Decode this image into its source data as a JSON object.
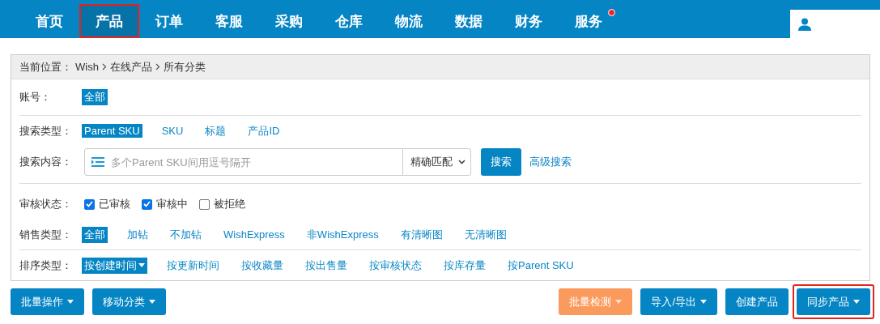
{
  "nav": {
    "items": [
      {
        "label": "首页",
        "selected": false,
        "highlighted": false,
        "badge": false
      },
      {
        "label": "产品",
        "selected": true,
        "highlighted": true,
        "badge": false
      },
      {
        "label": "订单",
        "selected": false,
        "highlighted": false,
        "badge": false
      },
      {
        "label": "客服",
        "selected": false,
        "highlighted": false,
        "badge": false
      },
      {
        "label": "采购",
        "selected": false,
        "highlighted": false,
        "badge": false
      },
      {
        "label": "仓库",
        "selected": false,
        "highlighted": false,
        "badge": false
      },
      {
        "label": "物流",
        "selected": false,
        "highlighted": false,
        "badge": false
      },
      {
        "label": "数据",
        "selected": false,
        "highlighted": false,
        "badge": false
      },
      {
        "label": "财务",
        "selected": false,
        "highlighted": false,
        "badge": false
      },
      {
        "label": "服务",
        "selected": false,
        "highlighted": false,
        "badge": true
      }
    ]
  },
  "breadcrumb": {
    "label": "当前位置：",
    "items": [
      "Wish",
      "在线产品",
      "所有分类"
    ]
  },
  "filters": [
    {
      "kind": "options",
      "label": "账号：",
      "divider": true,
      "options": [
        {
          "label": "全部",
          "selected": true,
          "dropdown": false
        }
      ]
    },
    {
      "kind": "options",
      "label": "搜索类型：",
      "divider": false,
      "options": [
        {
          "label": "Parent SKU",
          "selected": true,
          "dropdown": false
        },
        {
          "label": "SKU",
          "selected": false,
          "dropdown": false
        },
        {
          "label": "标题",
          "selected": false,
          "dropdown": false
        },
        {
          "label": "产品ID",
          "selected": false,
          "dropdown": false
        }
      ]
    },
    {
      "kind": "search",
      "label": "搜索内容：",
      "divider": true,
      "placeholder": "多个Parent SKU间用逗号隔开",
      "match": "精确匹配",
      "button": "搜索",
      "link": "高级搜索"
    },
    {
      "kind": "checks",
      "label": "审核状态：",
      "divider": false,
      "checks": [
        {
          "label": "已审核",
          "checked": true
        },
        {
          "label": "审核中",
          "checked": true
        },
        {
          "label": "被拒绝",
          "checked": false
        }
      ]
    },
    {
      "kind": "options",
      "label": "销售类型：",
      "divider": true,
      "options": [
        {
          "label": "全部",
          "selected": true,
          "dropdown": false
        },
        {
          "label": "加钻",
          "selected": false,
          "dropdown": false
        },
        {
          "label": "不加钻",
          "selected": false,
          "dropdown": false
        },
        {
          "label": "WishExpress",
          "selected": false,
          "dropdown": false
        },
        {
          "label": "非WishExpress",
          "selected": false,
          "dropdown": false
        },
        {
          "label": "有清晰图",
          "selected": false,
          "dropdown": false
        },
        {
          "label": "无清晰图",
          "selected": false,
          "dropdown": false
        }
      ]
    },
    {
      "kind": "options",
      "label": "排序类型：",
      "divider": false,
      "options": [
        {
          "label": "按创建时间",
          "selected": true,
          "dropdown": true
        },
        {
          "label": "按更新时间",
          "selected": false,
          "dropdown": false
        },
        {
          "label": "按收藏量",
          "selected": false,
          "dropdown": false
        },
        {
          "label": "按出售量",
          "selected": false,
          "dropdown": false
        },
        {
          "label": "按审核状态",
          "selected": false,
          "dropdown": false
        },
        {
          "label": "按库存量",
          "selected": false,
          "dropdown": false
        },
        {
          "label": "按Parent SKU",
          "selected": false,
          "dropdown": false
        }
      ]
    }
  ],
  "actions_left": [
    {
      "label": "批量操作",
      "kind": "primary",
      "dropdown": true,
      "highlighted": false
    },
    {
      "label": "移动分类",
      "kind": "primary",
      "dropdown": true,
      "highlighted": false
    }
  ],
  "actions_right": [
    {
      "label": "批量检测",
      "kind": "warning",
      "dropdown": true,
      "highlighted": false
    },
    {
      "label": "导入/导出",
      "kind": "primary",
      "dropdown": true,
      "highlighted": false
    },
    {
      "label": "创建产品",
      "kind": "primary",
      "dropdown": false,
      "highlighted": false
    },
    {
      "label": "同步产品",
      "kind": "primary",
      "dropdown": true,
      "highlighted": true
    }
  ]
}
